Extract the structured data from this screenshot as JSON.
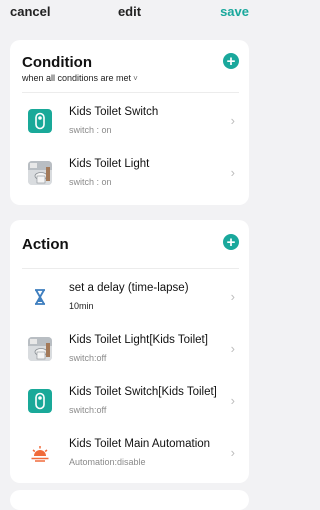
{
  "topbar": {
    "cancel": "cancel",
    "title": "edit",
    "save": "save"
  },
  "condition": {
    "title": "Condition",
    "mode": "when all conditions are met",
    "mode_chevron": "˅",
    "items": [
      {
        "name": "Kids Toilet Switch",
        "status": "switch : on",
        "icon": "switch-icon"
      },
      {
        "name": "Kids Toilet Light",
        "status": "switch : on",
        "icon": "toilet-light-photo"
      }
    ]
  },
  "action": {
    "title": "Action",
    "items": [
      {
        "name": "set a delay (time-lapse)",
        "status": "10min",
        "icon": "hourglass-icon"
      },
      {
        "name": "Kids Toilet Light[Kids Toilet]",
        "status": "switch:off",
        "icon": "toilet-light-photo"
      },
      {
        "name": "Kids Toilet Switch[Kids Toilet]",
        "status": "switch:off",
        "icon": "switch-icon"
      },
      {
        "name": "Kids Toilet Main Automation",
        "status": "Automation:disable",
        "icon": "sunset-icon"
      }
    ]
  },
  "colors": {
    "accent": "#1aa89c",
    "delay": "#3f7fbf",
    "sunset": "#f06b3a",
    "background": "#f2f2f4"
  }
}
